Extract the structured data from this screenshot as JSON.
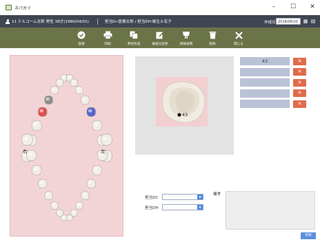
{
  "window": {
    "title": "ネパガイ"
  },
  "infobar": {
    "patient": "11 テルコーム太郎 男性 38才(1980/04/01)",
    "staff": "担当Dr:医療太郎 / 担当DH:衛生士花子",
    "date_label": "作成日",
    "date_value": "2018/06/20"
  },
  "toolbar": {
    "items": [
      {
        "label": "登録",
        "icon": "check-circle-icon"
      },
      {
        "label": "印刷",
        "icon": "printer-icon"
      },
      {
        "label": "参照作成",
        "icon": "copy-icon"
      },
      {
        "label": "検査日変更",
        "icon": "edit-icon"
      },
      {
        "label": "保険適用",
        "icon": "shop-icon"
      },
      {
        "label": "削除",
        "icon": "trash-icon"
      },
      {
        "label": "閉じる",
        "icon": "close-icon"
      }
    ]
  },
  "chart": {
    "right_label": "右",
    "left_label": "左"
  },
  "tooth_view": {
    "marker_label": "43"
  },
  "slots": [
    "43",
    "",
    "",
    "",
    ""
  ],
  "form": {
    "dc_label": "担当DC",
    "dh_label": "担当DH",
    "notes_label": "備考",
    "bottom_button": "登録"
  },
  "colors": {
    "infobar": "#3f4652",
    "toolbar": "#6b7348",
    "chart_bg": "#f3d4d6",
    "slot": "#b9c2d6",
    "delete": "#e06a4c",
    "button": "#5b8fe0"
  }
}
